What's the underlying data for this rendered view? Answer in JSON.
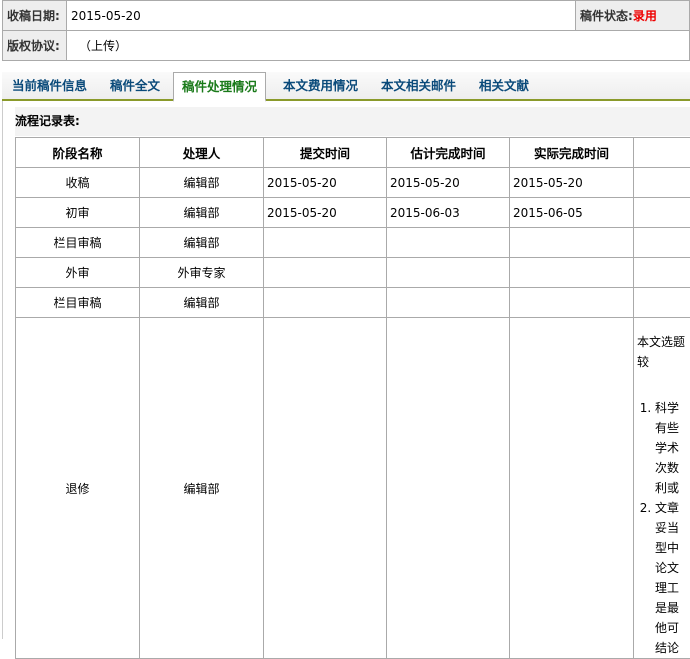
{
  "header": {
    "received_label": "收稿日期:",
    "received_value": "2015-05-20",
    "status_label": "稿件状态:",
    "status_value": "录用",
    "copyright_label": "版权协议:",
    "copyright_value": "（上传）"
  },
  "tabs": [
    {
      "label": "当前稿件信息"
    },
    {
      "label": "稿件全文"
    },
    {
      "label": "稿件处理情况"
    },
    {
      "label": "本文费用情况"
    },
    {
      "label": "本文相关邮件"
    },
    {
      "label": "相关文献"
    }
  ],
  "section_title": "流程记录表:",
  "columns": [
    "阶段名称",
    "处理人",
    "提交时间",
    "估计完成时间",
    "实际完成时间"
  ],
  "rows": [
    {
      "stage": "收稿",
      "handler": "编辑部",
      "submit": "2015-05-20",
      "estimate": "2015-05-20",
      "actual": "2015-05-20"
    },
    {
      "stage": "初审",
      "handler": "编辑部",
      "submit": "2015-05-20",
      "estimate": "2015-06-03",
      "actual": "2015-06-05"
    },
    {
      "stage": "栏目审稿",
      "handler": "编辑部",
      "submit": "",
      "estimate": "",
      "actual": ""
    },
    {
      "stage": "外审",
      "handler": "外审专家",
      "submit": "",
      "estimate": "",
      "actual": ""
    },
    {
      "stage": "栏目审稿",
      "handler": "编辑部",
      "submit": "",
      "estimate": "",
      "actual": ""
    },
    {
      "stage": "退修",
      "handler": "编辑部",
      "submit": "",
      "estimate": "",
      "actual": ""
    }
  ],
  "note": {
    "intro": "本文选题较",
    "items": [
      [
        "科学",
        "有些",
        "学术",
        "次数",
        "利或"
      ],
      [
        "文章",
        "妥当",
        "型中",
        "论文",
        "理工",
        "是最",
        "他可",
        "结论"
      ]
    ]
  }
}
